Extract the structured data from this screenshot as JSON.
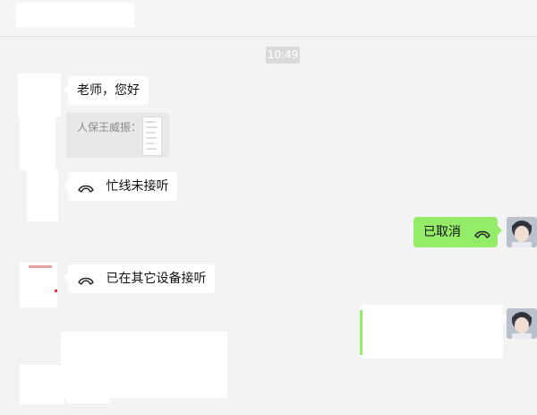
{
  "timestamp": "10:49",
  "messages": {
    "greeting": "老师，您好",
    "quote_sender": "人保王威振：",
    "missed_call": "忙线未接听",
    "cancelled": "已取消",
    "other_device": "已在其它设备接听"
  },
  "icons": {
    "call": "phone-hangup-icon"
  },
  "colors": {
    "sent_bubble": "#95ec69",
    "received_bubble": "#ffffff",
    "background": "#f3f3f3",
    "green_bar": "#95ec69"
  }
}
